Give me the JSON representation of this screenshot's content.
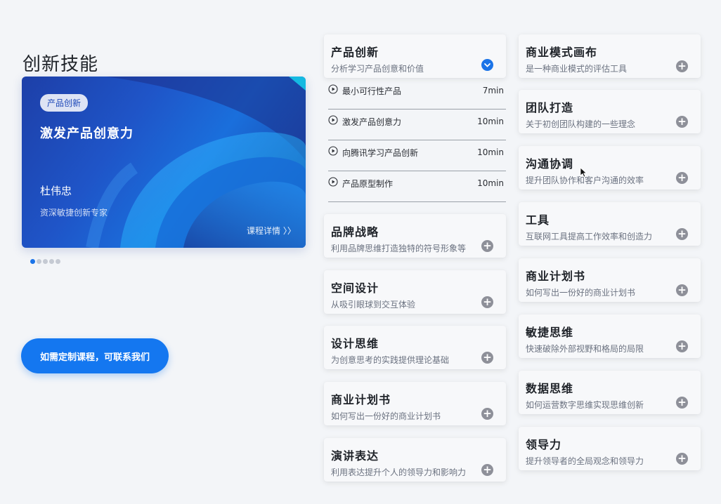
{
  "page": {
    "title": "创新技能",
    "cta_label": "如需定制课程，可联系我们"
  },
  "hero": {
    "badge": "产品创新",
    "title": "激发产品创意力",
    "author": "杜伟忠",
    "author_title": "资深敏捷创新专家",
    "detail_link": "课程详情 〉〉",
    "carousel_count": 5,
    "carousel_active": 1
  },
  "left_column": [
    {
      "title": "产品创新",
      "desc": "分析学习产品创意和价值",
      "expanded": true,
      "lessons": [
        {
          "label": "最小可行性产品",
          "duration": "7min"
        },
        {
          "label": "激发产品创意力",
          "duration": "10min"
        },
        {
          "label": "向腾讯学习产品创新",
          "duration": "10min"
        },
        {
          "label": "产品原型制作",
          "duration": "10min"
        }
      ]
    },
    {
      "title": "品牌战略",
      "desc": "利用品牌思维打造独特的符号形象等"
    },
    {
      "title": "空间设计",
      "desc": "从吸引眼球到交互体验"
    },
    {
      "title": "设计思维",
      "desc": "为创意思考的实践提供理论基础"
    },
    {
      "title": "商业计划书",
      "desc": "如何写出一份好的商业计划书"
    },
    {
      "title": "演讲表达",
      "desc": "利用表达提升个人的领导力和影响力"
    }
  ],
  "right_column": [
    {
      "title": "商业模式画布",
      "desc": "是一种商业模式的评估工具"
    },
    {
      "title": "团队打造",
      "desc": "关于初创团队构建的一些理念"
    },
    {
      "title": "沟通协调",
      "desc": "提升团队协作和客户沟通的效率"
    },
    {
      "title": "工具",
      "desc": "互联网工具提高工作效率和创造力"
    },
    {
      "title": "商业计划书",
      "desc": "如何写出一份好的商业计划书"
    },
    {
      "title": "敏捷思维",
      "desc": "快速破除外部视野和格局的局限"
    },
    {
      "title": "数据思维",
      "desc": "如何运营数字思维实现思维创新"
    },
    {
      "title": "领导力",
      "desc": "提升领导者的全局观念和领导力"
    }
  ],
  "icons": {
    "expand": "plus-circle-icon",
    "collapse": "chevron-down-icon",
    "lesson": "play-circle-icon"
  },
  "colors": {
    "accent": "#1477f0",
    "plus_icon": "#8e9099",
    "background": "#f3f5f8"
  }
}
